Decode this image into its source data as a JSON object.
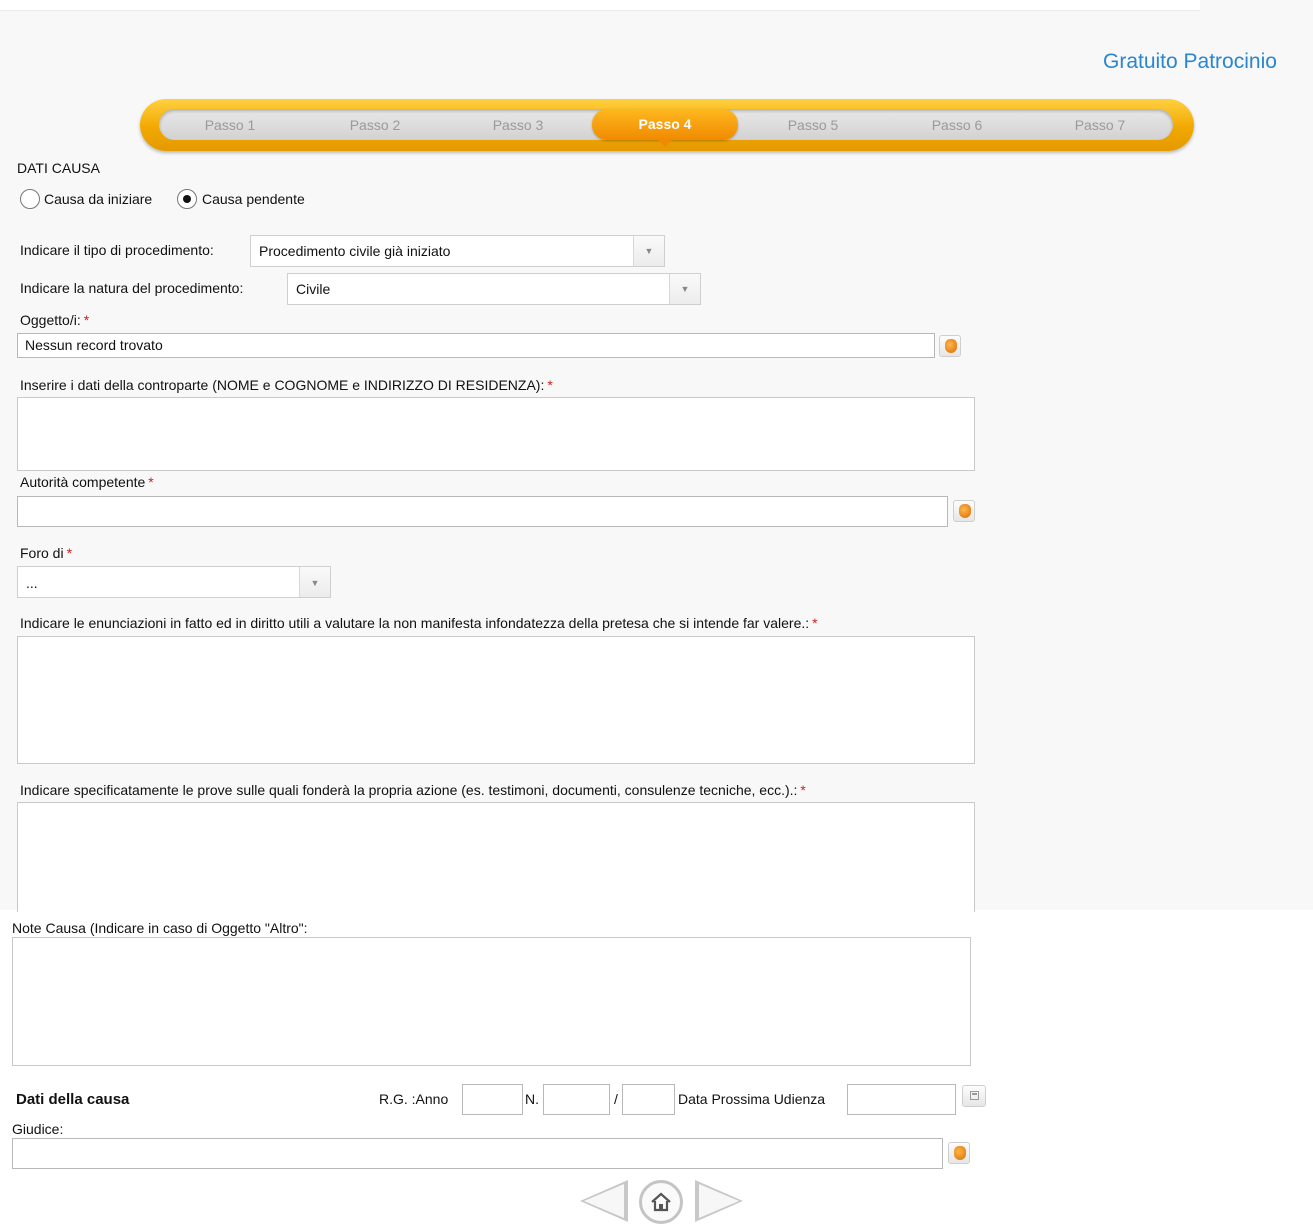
{
  "app": {
    "title": "Gratuito Patrocinio"
  },
  "stepper": {
    "steps": [
      "Passo 1",
      "Passo 2",
      "Passo 3",
      "Passo 4",
      "Passo 5",
      "Passo 6",
      "Passo 7"
    ],
    "active_step": "Passo 4"
  },
  "section": {
    "title": "DATI CAUSA"
  },
  "causa_type": {
    "options": [
      "Causa da iniziare",
      "Causa pendente"
    ],
    "selected": "Causa pendente"
  },
  "tipo_procedimento": {
    "label": "Indicare il tipo di procedimento:",
    "value": "Procedimento civile già iniziato"
  },
  "natura_procedimento": {
    "label": "Indicare la natura del procedimento:",
    "value": "Civile"
  },
  "oggetto": {
    "label": "Oggetto/i:",
    "value": "Nessun record trovato",
    "required_mark": "*"
  },
  "controparte": {
    "label": "Inserire i dati della controparte (NOME e COGNOME e INDIRIZZO DI RESIDENZA):",
    "required_mark": "*"
  },
  "autorita": {
    "label": "Autorità competente",
    "required_mark": "*",
    "value": ""
  },
  "foro": {
    "label": "Foro di",
    "required_mark": "*",
    "value": "..."
  },
  "enunciazioni": {
    "label": "Indicare le enunciazioni in fatto ed in diritto utili a valutare la non manifesta infondatezza della pretesa che si intende far valere.:",
    "required_mark": "*"
  },
  "prove": {
    "label": "Indicare specificatamente le prove sulle quali fonderà la propria azione (es. testimoni, documenti, consulenze tecniche, ecc.).:",
    "required_mark": "*"
  },
  "note_causa": {
    "label": "Note Causa (Indicare in caso di Oggetto \"Altro\":"
  },
  "dati_causa": {
    "title": "Dati della causa",
    "rg_anno_label": "R.G. :Anno",
    "rg_anno_value": "",
    "n_label": "N.",
    "n_value": "",
    "slash": "/",
    "suffix_value": "",
    "data_udienza_label": "Data Prossima Udienza",
    "data_udienza_value": ""
  },
  "giudice": {
    "label": "Giudice:",
    "value": ""
  },
  "icons": {
    "picker": "hand-pointer-icon",
    "calendar": "calendar-icon",
    "prev": "arrow-left-icon",
    "home": "home-icon",
    "next": "arrow-right-icon"
  }
}
